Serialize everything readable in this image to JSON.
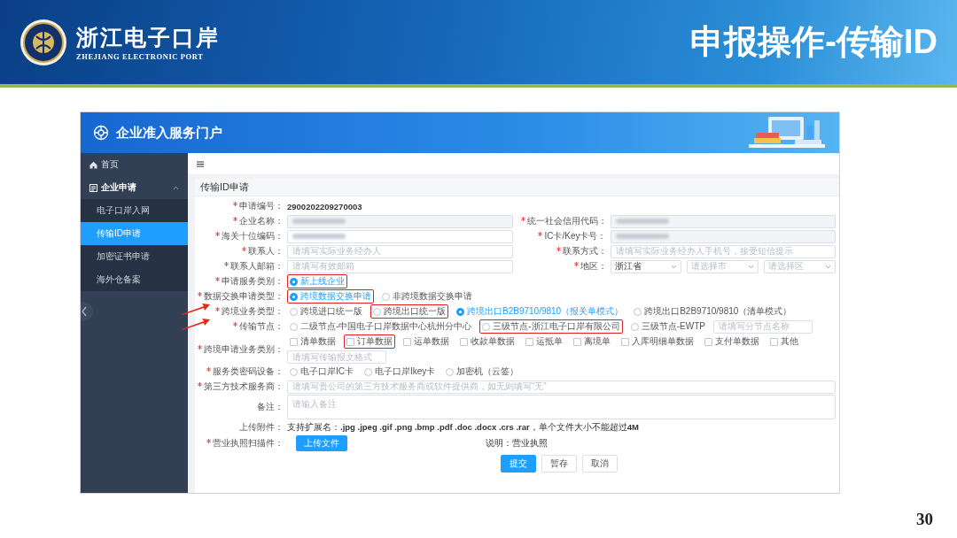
{
  "slide": {
    "brand_cn": "浙江电子口岸",
    "brand_en": "ZHEJIANG ELECTRONIC PORT",
    "title": "申报操作-传输ID",
    "page_number": "30"
  },
  "app": {
    "title": "企业准入服务门户",
    "sidebar": [
      {
        "label": "首页",
        "kind": "home"
      },
      {
        "label": "企业申请",
        "kind": "group",
        "expanded": true,
        "children": [
          {
            "label": "电子口岸入网",
            "selected": false
          },
          {
            "label": "传输ID申请",
            "selected": true
          },
          {
            "label": "加密证书申请",
            "selected": false
          },
          {
            "label": "海外仓备案",
            "selected": false
          }
        ]
      }
    ],
    "page_title": "传输ID申请",
    "form": {
      "rows": [
        {
          "fields": [
            {
              "label": "申请编号：",
              "required": true,
              "kind": "text",
              "value": "2900202209270003"
            }
          ]
        },
        {
          "fields": [
            {
              "label": "企业名称：",
              "required": true,
              "kind": "input",
              "disabled": true,
              "redacted": true
            },
            {
              "label": "统一社会信用代码：",
              "required": true,
              "kind": "input",
              "disabled": true,
              "redacted": true
            }
          ]
        },
        {
          "fields": [
            {
              "label": "海关十位编码：",
              "required": true,
              "kind": "input",
              "disabled": false,
              "redacted": true
            },
            {
              "label": "IC卡/Key卡号：",
              "required": true,
              "kind": "input",
              "disabled": true,
              "redacted": true
            }
          ]
        },
        {
          "fields": [
            {
              "label": "联系人：",
              "required": true,
              "kind": "input",
              "disabled": false,
              "redacted": false,
              "placeholder": "请填写实际业务经办人"
            },
            {
              "label": "联系方式：",
              "required": true,
              "kind": "input",
              "disabled": false,
              "redacted": false,
              "placeholder": "请填写实际业务经办人手机号，接受短信提示"
            }
          ]
        },
        {
          "fields": [
            {
              "label": "联系人邮箱：",
              "required": true,
              "kind": "input",
              "disabled": false,
              "redacted": false,
              "placeholder": "请填写有效邮箱"
            },
            {
              "label": "地区：",
              "required": true,
              "kind": "selects",
              "selects": [
                {
                  "value": "浙江省"
                },
                {
                  "placeholder": "请选择市"
                },
                {
                  "placeholder": "请选择区"
                }
              ]
            }
          ]
        },
        {
          "fields": [
            {
              "label": "申请服务类别：",
              "required": true,
              "kind": "radio",
              "options": [
                {
                  "label": "新上线企业",
                  "selected": true,
                  "highlighted": true
                }
              ]
            }
          ]
        },
        {
          "fields": [
            {
              "label": "数据交换申请类型：",
              "required": true,
              "kind": "radio",
              "options": [
                {
                  "label": "跨境数据交换申请",
                  "selected": true,
                  "highlighted": true
                },
                {
                  "label": "非跨境数据交换申请",
                  "selected": false,
                  "highlighted": false
                }
              ]
            }
          ]
        },
        {
          "fields": [
            {
              "label": "跨境业务类型：",
              "required": true,
              "arrow": true,
              "kind": "radio",
              "options": [
                {
                  "label": "跨境进口统一版",
                  "selected": false,
                  "highlighted": false
                },
                {
                  "label": "跨境出口统一版",
                  "selected": false,
                  "highlighted": true
                },
                {
                  "label": "跨境出口B2B9710/9810（报关单模式）",
                  "selected": true,
                  "highlighted": false
                },
                {
                  "label": "跨境出口B2B9710/9810（清单模式）",
                  "selected": false,
                  "highlighted": false
                }
              ]
            }
          ]
        },
        {
          "fields": [
            {
              "label": "传输节点：",
              "required": true,
              "arrow": true,
              "kind": "radio",
              "options": [
                {
                  "label": "二级节点-中国电子口岸数据中心杭州分中心",
                  "selected": false,
                  "highlighted": false
                },
                {
                  "label": "三级节点-浙江电子口岸有限公司",
                  "selected": false,
                  "highlighted": true
                },
                {
                  "label": "三级节点-EWTP",
                  "selected": false,
                  "highlighted": false
                }
              ],
              "extra_placeholder": "请填写分节点名称"
            }
          ]
        },
        {
          "fields": [
            {
              "label": "跨境申请业务类别：",
              "required": true,
              "kind": "checkbox",
              "options": [
                {
                  "label": "清单数据",
                  "checked": false,
                  "highlighted": false
                },
                {
                  "label": "订单数据",
                  "checked": false,
                  "highlighted": true
                },
                {
                  "label": "运单数据",
                  "checked": false,
                  "highlighted": false
                },
                {
                  "label": "收款单数据",
                  "checked": false,
                  "highlighted": false
                },
                {
                  "label": "运抵单",
                  "checked": false,
                  "highlighted": false
                },
                {
                  "label": "离境单",
                  "checked": false,
                  "highlighted": false
                },
                {
                  "label": "入库明细单数据",
                  "checked": false,
                  "highlighted": false
                },
                {
                  "label": "支付单数据",
                  "checked": false,
                  "highlighted": false
                },
                {
                  "label": "其他",
                  "checked": false,
                  "highlighted": false
                }
              ],
              "extra_placeholder": "请填写传输报文格式"
            }
          ]
        },
        {
          "fields": [
            {
              "label": "服务类密码设备：",
              "required": true,
              "kind": "radio",
              "options": [
                {
                  "label": "电子口岸IC卡",
                  "selected": false,
                  "highlighted": false
                },
                {
                  "label": "电子口岸Ikey卡",
                  "selected": false,
                  "highlighted": false
                },
                {
                  "label": "加密机（云签）",
                  "selected": false,
                  "highlighted": false
                }
              ]
            }
          ]
        },
        {
          "fields": [
            {
              "label": "第三方技术服务商：",
              "required": true,
              "kind": "input",
              "disabled": false,
              "redacted": false,
              "placeholder": "请填写贵公司的第三方技术服务商或软件提供商，如无则填写“无”"
            }
          ]
        },
        {
          "fields": [
            {
              "label": "备注：",
              "required": false,
              "kind": "textarea",
              "placeholder": "请输入备注"
            }
          ]
        },
        {
          "fields": [
            {
              "label": "上传附件：",
              "required": false,
              "kind": "note",
              "text": "支持扩展名：**.jpg .jpeg .gif .png .bmp .pdf .doc .docx .crs .rar**，单个文件大小不能超过**4M**"
            }
          ]
        },
        {
          "fields": [
            {
              "label": "营业执照扫描件：",
              "required": true,
              "kind": "upload",
              "button": "上传文件",
              "note": "说明：营业执照"
            }
          ]
        }
      ]
    },
    "buttons": [
      {
        "label": "提交",
        "primary": true
      },
      {
        "label": "暂存",
        "primary": false
      },
      {
        "label": "取消",
        "primary": false
      }
    ]
  }
}
